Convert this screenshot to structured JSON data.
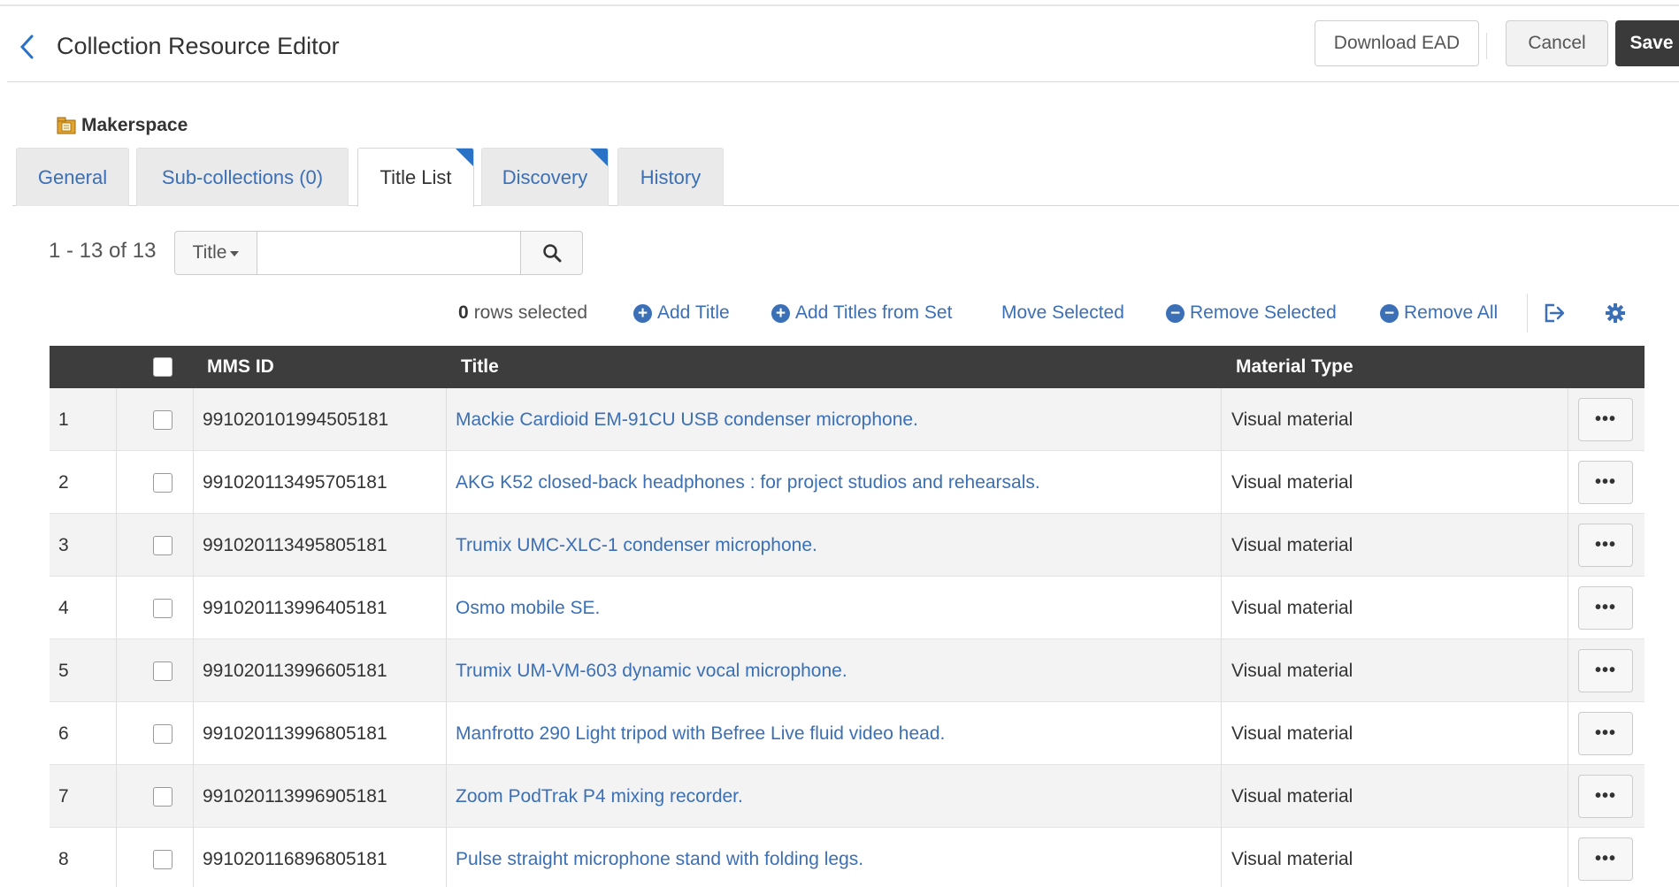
{
  "header": {
    "title": "Collection Resource Editor",
    "download_label": "Download EAD",
    "cancel_label": "Cancel",
    "save_label": "Save"
  },
  "collection": {
    "name": "Makerspace"
  },
  "tabs": [
    {
      "label": "General"
    },
    {
      "label": "Sub-collections (0)"
    },
    {
      "label": "Title List"
    },
    {
      "label": "Discovery"
    },
    {
      "label": "History"
    }
  ],
  "list": {
    "count_text": "1 - 13 of 13",
    "search_field": "Title",
    "search_value": ""
  },
  "toolbar": {
    "selected_count": "0",
    "selected_text": "rows selected",
    "add_title": "Add Title",
    "add_titles_from_set": "Add Titles from Set",
    "move_selected": "Move Selected",
    "remove_selected": "Remove Selected",
    "remove_all": "Remove All"
  },
  "table": {
    "columns": {
      "mms_id": "MMS ID",
      "title": "Title",
      "material_type": "Material Type"
    },
    "rows": [
      {
        "num": "1",
        "mms_id": "991020101994505181",
        "title": "Mackie Cardioid EM-91CU USB condenser microphone.",
        "material_type": "Visual material"
      },
      {
        "num": "2",
        "mms_id": "991020113495705181",
        "title": "AKG K52 closed-back headphones : for project studios and rehearsals.",
        "material_type": "Visual material"
      },
      {
        "num": "3",
        "mms_id": "991020113495805181",
        "title": "Trumix UMC-XLC-1 condenser microphone.",
        "material_type": "Visual material"
      },
      {
        "num": "4",
        "mms_id": "991020113996405181",
        "title": "Osmo mobile SE.",
        "material_type": "Visual material"
      },
      {
        "num": "5",
        "mms_id": "991020113996605181",
        "title": "Trumix UM-VM-603 dynamic vocal microphone.",
        "material_type": "Visual material"
      },
      {
        "num": "6",
        "mms_id": "991020113996805181",
        "title": "Manfrotto 290 Light tripod with Befree Live fluid video head.",
        "material_type": "Visual material"
      },
      {
        "num": "7",
        "mms_id": "991020113996905181",
        "title": "Zoom PodTrak P4 mixing recorder.",
        "material_type": "Visual material"
      },
      {
        "num": "8",
        "mms_id": "991020116896805181",
        "title": "Pulse straight microphone stand with folding legs.",
        "material_type": "Visual material"
      }
    ]
  },
  "colors": {
    "link": "#3b6fb6",
    "header_bg": "#3d3d3d",
    "save_bg": "#3a3a3a",
    "tab_marker": "#2a72c6"
  }
}
